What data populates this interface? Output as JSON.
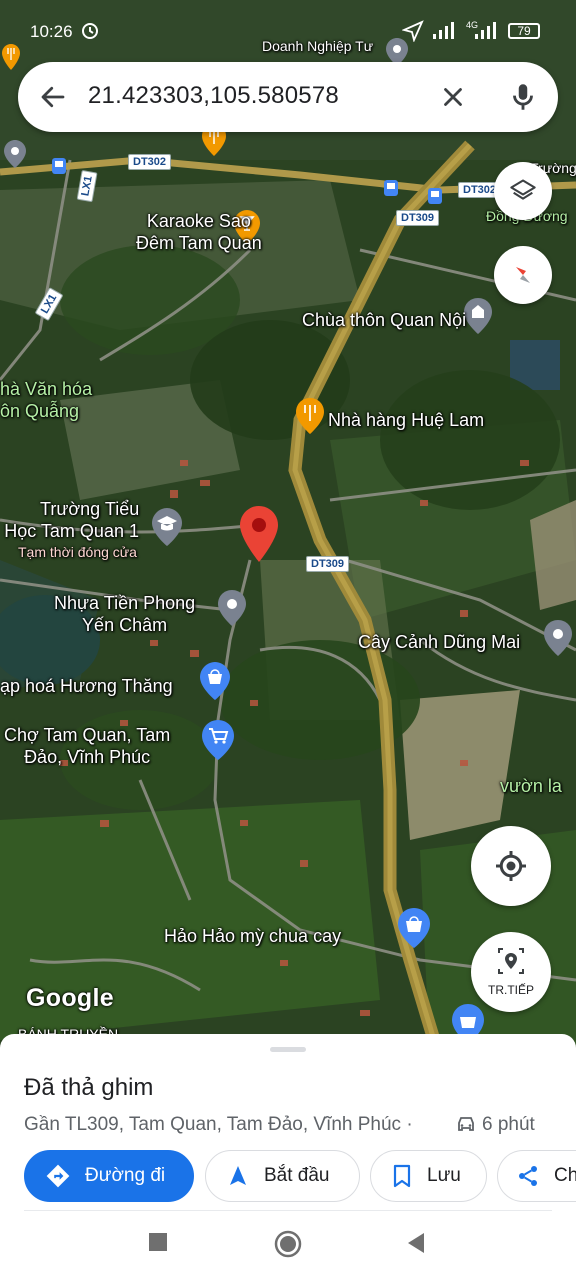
{
  "status_bar": {
    "time": "10:26",
    "battery": "79",
    "network": "4G"
  },
  "search": {
    "query": "21.423303,105.580578"
  },
  "map": {
    "labels": {
      "doanh_nghiep": "Doanh Nghiệp Tư",
      "karaoke_line1": "Karaoke Sao",
      "karaoke_line2": "Đêm Tam Quan",
      "chua": "Chùa thôn Quan Nội",
      "nha_van_hoa_line1": "hà Văn hóa",
      "nha_van_hoa_line2": "ôn Quẫng",
      "nha_hang": "Nhà hàng Huệ Lam",
      "truong_line1": "Trường Tiểu",
      "truong_line2": "Học Tam Quan 1",
      "truong_status": "Tạm thời đóng cửa",
      "nhua_line1": "Nhựa Tiền Phong",
      "nhua_line2": "Yến Châm",
      "cay_canh": "Cây Cảnh Dũng Mai",
      "tap_hoa": "ạp hoá Hương Thăng",
      "cho_line1": "Chợ Tam Quan, Tam",
      "cho_line2": "Đảo, Vĩnh Phúc",
      "vuon": "vườn la",
      "hao_hao": "Hảo Hảo mỳ chua cay",
      "truong_right": "Trường T",
      "dong_duong": "Đồng Dương",
      "banh_truyen": "BÁNH TRUYỀN"
    },
    "roads": [
      "DT302",
      "DT302",
      "DT309",
      "DT309",
      "LX1",
      "LX1"
    ],
    "attribution": "Google",
    "colors": {
      "main_road": "#a08a3a",
      "pin": "#ea4335",
      "accent": "#1a73e8"
    }
  },
  "controls": {
    "layers_icon": "layers-icon",
    "compass_icon": "compass-icon",
    "location_icon": "my-location-icon",
    "live_view_label": "TR.TIẾP"
  },
  "place": {
    "title": "Đã thả ghim",
    "address": "Gần TL309, Tam Quan, Tam Đảo, Vĩnh Phúc ·",
    "drive_time": "6 phút"
  },
  "actions": {
    "directions": "Đường đi",
    "start": "Bắt đầu",
    "save": "Lưu",
    "share": "Ch"
  }
}
